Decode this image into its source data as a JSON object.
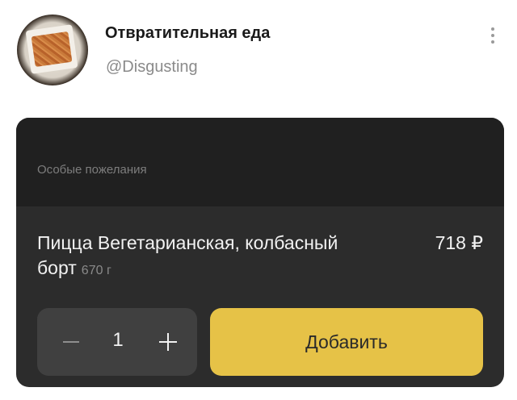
{
  "post": {
    "channel_name": "Отвратительная еда",
    "channel_handle": "@Disgusting",
    "menu_icon": "more-vertical-icon",
    "avatar_icon": "food-photo-avatar"
  },
  "order_card": {
    "wishes_placeholder": "Особые пожелания",
    "item": {
      "title": "Пицца Вегетарианская, колбасный борт",
      "weight": "670 г",
      "price": "718 ₽"
    },
    "stepper": {
      "minus_icon": "minus-icon",
      "plus_icon": "plus-icon",
      "quantity": "1"
    },
    "add_label": "Добавить",
    "colors": {
      "card_background": "#2c2c2c",
      "accent": "#e6c247",
      "stepper_background": "#404040"
    }
  }
}
